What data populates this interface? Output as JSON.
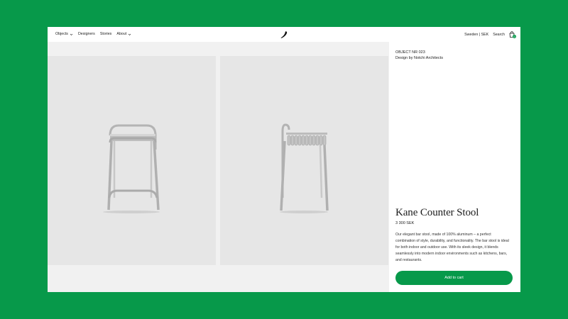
{
  "header": {
    "nav": [
      {
        "label": "Objects",
        "has_dropdown": true
      },
      {
        "label": "Designers",
        "has_dropdown": false
      },
      {
        "label": "Stories",
        "has_dropdown": false
      },
      {
        "label": "About",
        "has_dropdown": true
      }
    ],
    "logo_icon": "brand-logo-icon",
    "region": "Sweden | SEK",
    "search_label": "Search",
    "cart_icon": "shopping-bag-icon",
    "cart_count": "0"
  },
  "gallery": {
    "images": [
      {
        "name": "stool-front-view"
      },
      {
        "name": "stool-side-view"
      }
    ]
  },
  "product": {
    "object_number": "OBJECT NR 023",
    "designer": "Design by Notchi Architects",
    "name": "Kane Counter Stool",
    "price": "3 300 SEK",
    "description": "Our elegant bar stool, made of 100% aluminum – a perfect combination of style, durability, and functionality. The bar stool is ideal for both indoor and outdoor use. With its sleek design, it blends seamlessly into modern indoor environments such as kitchens, bars, and restaurants.",
    "add_to_cart_label": "Add to cart"
  },
  "colors": {
    "brand_green": "#07994a",
    "photo_bg": "#e6e6e6",
    "page_bg": "#f1f1f1"
  }
}
